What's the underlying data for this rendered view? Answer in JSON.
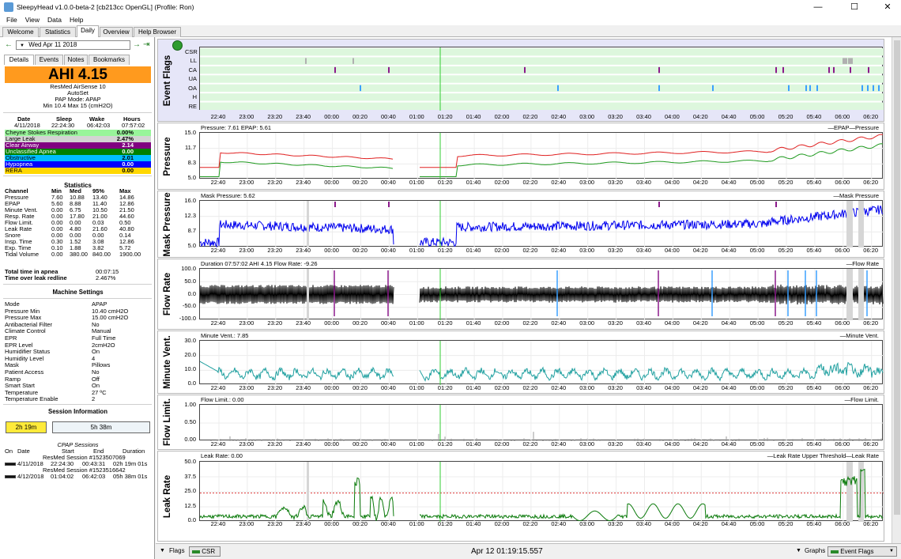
{
  "window": {
    "title": "SleepyHead v1.0.0-beta-2 [cb213cc OpenGL] (Profile: Ron)",
    "controls": [
      "—",
      "☐",
      "✕"
    ]
  },
  "menu": [
    "File",
    "View",
    "Data",
    "Help"
  ],
  "tabs": [
    "Welcome",
    "Statistics",
    "Daily",
    "Overview",
    "Help Browser"
  ],
  "active_tab": "Daily",
  "date_nav": {
    "prev": "←",
    "date": "Wed Apr 11 2018",
    "next": "→",
    "last": "⇥",
    "cal": "▼"
  },
  "subtabs": [
    "Details",
    "Events",
    "Notes",
    "Bookmarks"
  ],
  "ahi": "AHI 4.15",
  "machine": {
    "name": "ResMed AirSense 10",
    "model": "AutoSet",
    "mode": "PAP Mode: APAP",
    "range": "Min 10.4 Max 15 (cmH2O)"
  },
  "summary": {
    "headers": [
      "Date",
      "Sleep",
      "Wake",
      "Hours"
    ],
    "values": [
      "4/11/2018",
      "22:24:30",
      "06:42:03",
      "07:57:02"
    ]
  },
  "events": [
    {
      "label": "Cheyne Stokes Respiration",
      "value": "0.00%",
      "bg": "#98f59a",
      "fg": "#000000"
    },
    {
      "label": "Large Leak",
      "value": "2.47%",
      "bg": "#d3d3d3",
      "fg": "#000000"
    },
    {
      "label": "Clear Airway",
      "value": "2.14",
      "bg": "#800080",
      "fg": "#ffffff"
    },
    {
      "label": "Unclassified Apnea",
      "value": "0.00",
      "bg": "#008000",
      "fg": "#ffffff"
    },
    {
      "label": "Obstructive",
      "value": "2.01",
      "bg": "#00bfff",
      "fg": "#000000"
    },
    {
      "label": "Hypopnea",
      "value": "0.00",
      "bg": "#0000ff",
      "fg": "#ffffff"
    },
    {
      "label": "RERA",
      "value": "0.00",
      "bg": "#ffd700",
      "fg": "#000000"
    }
  ],
  "statistics": {
    "heading": "Statistics",
    "headers": [
      "Channel",
      "Min",
      "Med",
      "95%",
      "Max"
    ],
    "rows": [
      [
        "Pressure",
        "7.60",
        "10.88",
        "13.40",
        "14.86"
      ],
      [
        "EPAP",
        "5.60",
        "8.88",
        "11.40",
        "12.86"
      ],
      [
        "Minute Vent.",
        "0.00",
        "6.75",
        "10.50",
        "21.50"
      ],
      [
        "Resp. Rate",
        "0.00",
        "17.80",
        "21.00",
        "44.60"
      ],
      [
        "Flow Limit.",
        "0.00",
        "0.00",
        "0.03",
        "0.50"
      ],
      [
        "Leak Rate",
        "0.00",
        "4.80",
        "21.60",
        "40.80"
      ],
      [
        "Snore",
        "0.00",
        "0.00",
        "0.00",
        "0.14"
      ],
      [
        "Insp. Time",
        "0.30",
        "1.52",
        "3.08",
        "12.86"
      ],
      [
        "Exp. Time",
        "0.10",
        "1.88",
        "3.82",
        "5.72"
      ],
      [
        "Tidal Volume",
        "0.00",
        "380.00",
        "840.00",
        "1900.00"
      ]
    ],
    "apnea_label": "Total time in apnea",
    "apnea_value": "00:07:15",
    "leak_label": "Time over leak redline",
    "leak_value": "2.467%"
  },
  "machine_settings": {
    "heading": "Machine Settings",
    "rows": [
      [
        "Mode",
        "APAP"
      ],
      [
        "Pressure Min",
        "10.40 cmH2O"
      ],
      [
        "Pressure Max",
        "15.00 cmH2O"
      ],
      [
        "Antibacterial Filter",
        "No"
      ],
      [
        "Climate Control",
        "Manual"
      ],
      [
        "EPR",
        "Full Time"
      ],
      [
        "EPR Level",
        "2cmH2O"
      ],
      [
        "Humidifier Status",
        "On"
      ],
      [
        "Humidity Level",
        "4"
      ],
      [
        "Mask",
        "Pillows"
      ],
      [
        "Patient Access",
        "No"
      ],
      [
        "Ramp",
        "Off"
      ],
      [
        "Smart Start",
        "On"
      ],
      [
        "Temperature",
        "27 ºC"
      ],
      [
        "Temperature Enable",
        "2"
      ]
    ]
  },
  "session_info": {
    "heading": "Session Information",
    "btn1": "2h 19m",
    "btn2": "5h 38m",
    "cpap_title": "CPAP Sessions",
    "headers": [
      "On",
      "Date",
      "Start",
      "End",
      "Duration"
    ],
    "sessions": [
      {
        "name": "ResMed Session #1523507069",
        "date": "4/11/2018",
        "start": "22:24:30",
        "end": "00:43:31",
        "dur": "02h 19m 01s"
      },
      {
        "name": "ResMed Session #1523516642",
        "date": "4/12/2018",
        "start": "01:04:02",
        "end": "06:42:03",
        "dur": "05h 38m 01s"
      }
    ]
  },
  "time_labels": [
    "22:40",
    "23:00",
    "23:20",
    "23:40",
    "00:00",
    "00:20",
    "00:40",
    "01:00",
    "01:20",
    "01:40",
    "02:00",
    "02:20",
    "02:40",
    "03:00",
    "03:20",
    "03:40",
    "04:00",
    "04:20",
    "04:40",
    "05:00",
    "05:20",
    "05:40",
    "06:00",
    "06:20"
  ],
  "graphs": {
    "flags": {
      "label": "Event Flags",
      "rows": [
        "CSR",
        "LL",
        "CA",
        "UA",
        "OA",
        "H",
        "RE"
      ]
    },
    "pressure": {
      "label": "Pressure",
      "title": "Pressure: 7.61 EPAP: 5.61",
      "legend": "—EPAP—Pressure",
      "yticks": [
        "15.0",
        "11.7",
        "8.3",
        "5.0"
      ]
    },
    "mask": {
      "label": "Mask Pressure",
      "title": "Mask Pressure: 5.62",
      "legend": "—Mask Pressure",
      "yticks": [
        "16.0",
        "12.3",
        "8.7",
        "5.0"
      ]
    },
    "flow": {
      "label": "Flow Rate",
      "title": "Duration 07:57:02 AHI 4.15 Flow Rate: -9.26",
      "legend": "—Flow Rate",
      "yticks": [
        "100.0",
        "50.0",
        "0.0",
        "-50.0",
        "-100.0"
      ]
    },
    "minvent": {
      "label": "Minute Vent.",
      "title": "Minute Vent.: 7.85",
      "legend": "—Minute Vent.",
      "yticks": [
        "30.0",
        "20.0",
        "10.0",
        "0.0"
      ]
    },
    "flowlim": {
      "label": "Flow Limit.",
      "title": "Flow Limit.: 0.00",
      "legend": "—Flow Limit.",
      "yticks": [
        "1.00",
        "0.50",
        "0.00"
      ]
    },
    "leak": {
      "label": "Leak Rate",
      "title": "Leak Rate: 0.00",
      "legend": "—Leak Rate Upper Threshold—Leak Rate",
      "yticks": [
        "50.0",
        "37.5",
        "25.0",
        "12.5",
        "0.0"
      ]
    }
  },
  "bottom": {
    "flags_label": "Flags",
    "flags_value": "CSR",
    "timestamp": "Apr 12 01:19:15.557",
    "graphs_label": "Graphs",
    "graphs_value": "Event Flags"
  }
}
